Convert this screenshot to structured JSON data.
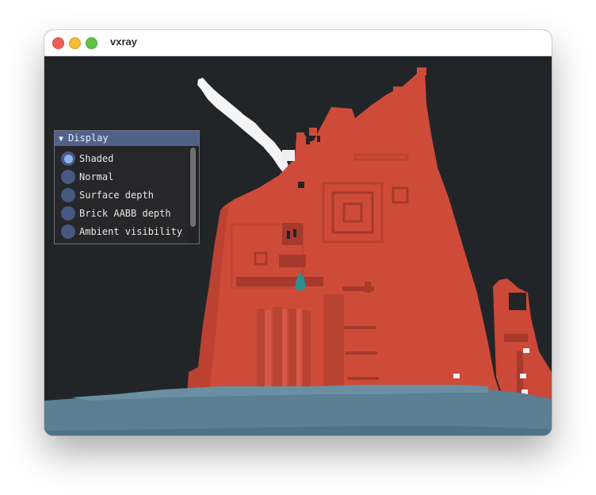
{
  "window": {
    "title": "vxray",
    "traffic_lights": [
      "close",
      "minimize",
      "zoom"
    ]
  },
  "panel": {
    "header": "Display",
    "options": [
      {
        "label": "Shaded",
        "selected": true
      },
      {
        "label": "Normal",
        "selected": false
      },
      {
        "label": "Surface depth",
        "selected": false
      },
      {
        "label": "Brick AABB depth",
        "selected": false
      },
      {
        "label": "Ambient visibility",
        "selected": false
      }
    ]
  },
  "scene": {
    "description_icon": "voxel-castle-render",
    "colors": {
      "background": "#222528",
      "building": "#cf4b39",
      "building_dark": "#a53a2d",
      "ground": "#5b7f93",
      "highlight": "#f2f2f2"
    }
  }
}
